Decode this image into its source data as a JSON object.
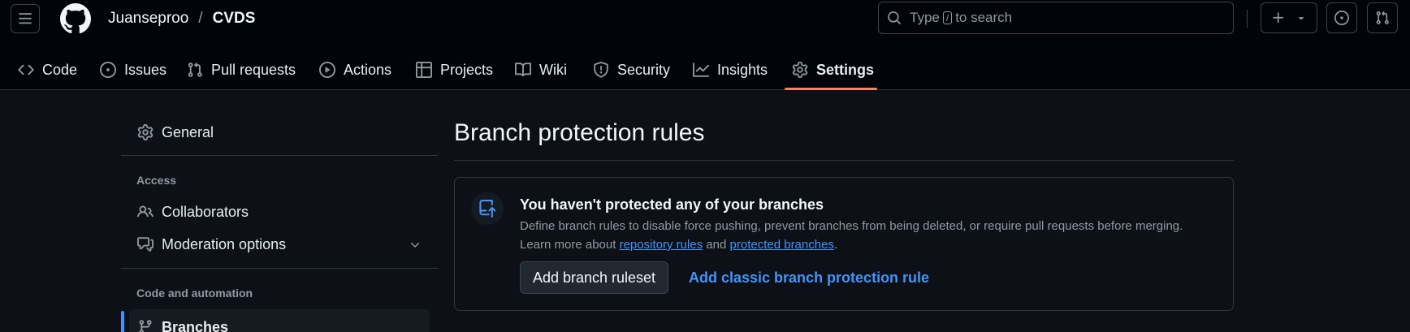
{
  "header": {
    "owner": "Juanseproo",
    "separator": "/",
    "repo": "CVDS",
    "search_prefix": "Type",
    "search_key": "/",
    "search_suffix": "to search"
  },
  "tabs": [
    {
      "label": "Code",
      "icon": "code-icon"
    },
    {
      "label": "Issues",
      "icon": "issue-opened-icon"
    },
    {
      "label": "Pull requests",
      "icon": "git-pull-request-icon"
    },
    {
      "label": "Actions",
      "icon": "play-icon"
    },
    {
      "label": "Projects",
      "icon": "table-icon"
    },
    {
      "label": "Wiki",
      "icon": "book-icon"
    },
    {
      "label": "Security",
      "icon": "shield-icon"
    },
    {
      "label": "Insights",
      "icon": "graph-icon"
    },
    {
      "label": "Settings",
      "icon": "gear-icon",
      "active": true
    }
  ],
  "sidebar": {
    "general": "General",
    "access_heading": "Access",
    "collaborators": "Collaborators",
    "moderation": "Moderation options",
    "code_heading": "Code and automation",
    "branches": "Branches"
  },
  "main": {
    "title": "Branch protection rules",
    "blank_title": "You haven't protected any of your branches",
    "blank_desc": "Define branch rules to disable force pushing, prevent branches from being deleted, or require pull requests before merging.",
    "learn_prefix": "Learn more about",
    "link_repo_rules": "repository rules",
    "learn_and": "and",
    "link_protected": "protected branches",
    "learn_end": ".",
    "add_ruleset": "Add branch ruleset",
    "add_classic": "Add classic branch protection rule"
  },
  "colors": {
    "accent": "#4493f8",
    "active_tab_underline": "#f78166",
    "background": "#0d1117",
    "header_background": "#010409"
  }
}
